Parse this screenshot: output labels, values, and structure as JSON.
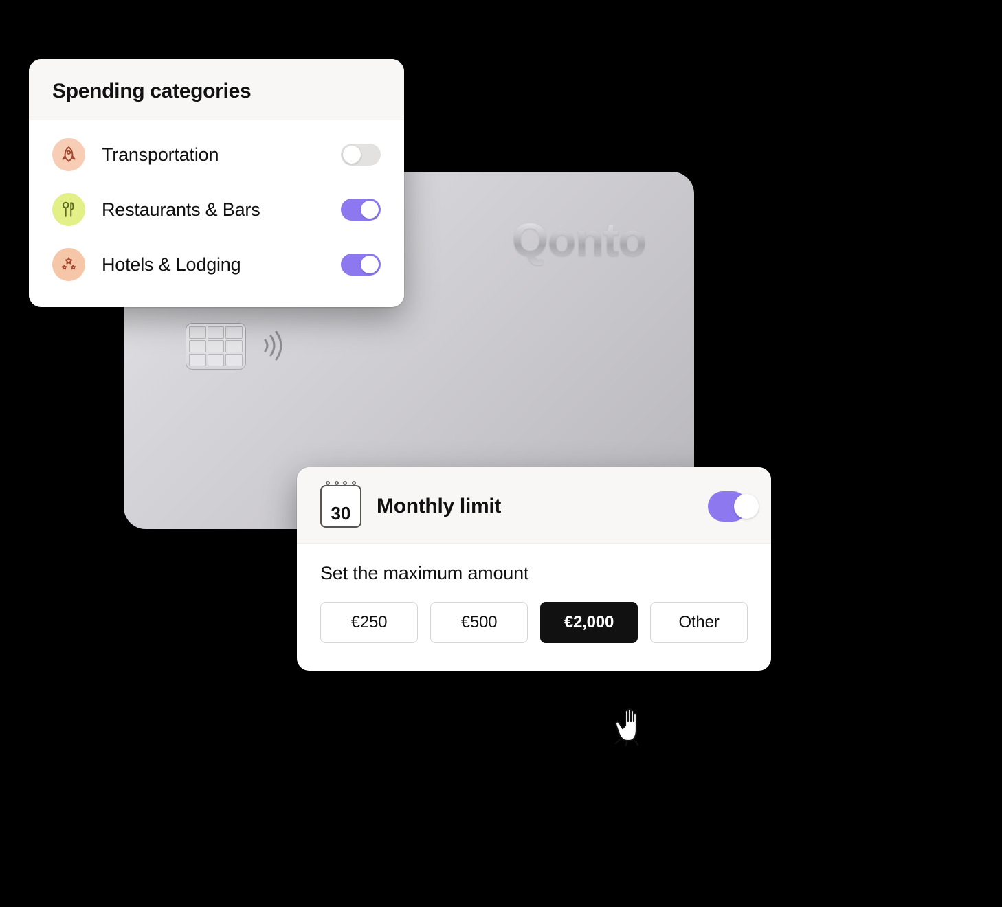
{
  "card": {
    "brand": "Qonto"
  },
  "spending_panel": {
    "title": "Spending categories",
    "categories": [
      {
        "label": "Transportation",
        "icon": "rocket-icon",
        "enabled": false
      },
      {
        "label": "Restaurants & Bars",
        "icon": "utensils-icon",
        "enabled": true
      },
      {
        "label": "Hotels & Lodging",
        "icon": "stars-icon",
        "enabled": true
      }
    ]
  },
  "limit_panel": {
    "calendar_day": "30",
    "title": "Monthly limit",
    "enabled": true,
    "subtitle": "Set the maximum amount",
    "amounts": [
      {
        "label": "€250",
        "selected": false
      },
      {
        "label": "€500",
        "selected": false
      },
      {
        "label": "€2,000",
        "selected": true
      },
      {
        "label": "Other",
        "selected": false
      }
    ]
  },
  "colors": {
    "accent": "#8d78f0"
  }
}
